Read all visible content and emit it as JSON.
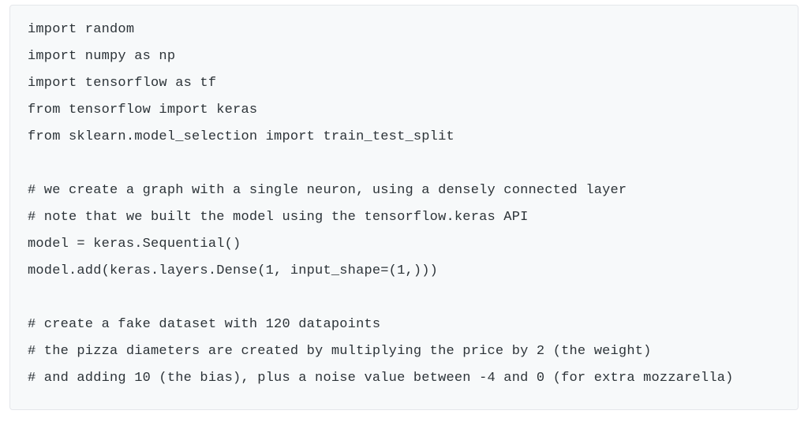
{
  "code": {
    "lines": [
      "import random",
      "import numpy as np",
      "import tensorflow as tf",
      "from tensorflow import keras",
      "from sklearn.model_selection import train_test_split",
      "",
      "# we create a graph with a single neuron, using a densely connected layer",
      "# note that we built the model using the tensorflow.keras API",
      "model = keras.Sequential()",
      "model.add(keras.layers.Dense(1, input_shape=(1,)))",
      "",
      "# create a fake dataset with 120 datapoints",
      "# the pizza diameters are created by multiplying the price by 2 (the weight)",
      "# and adding 10 (the bias), plus a noise value between -4 and 0 (for extra mozzarella)"
    ]
  }
}
